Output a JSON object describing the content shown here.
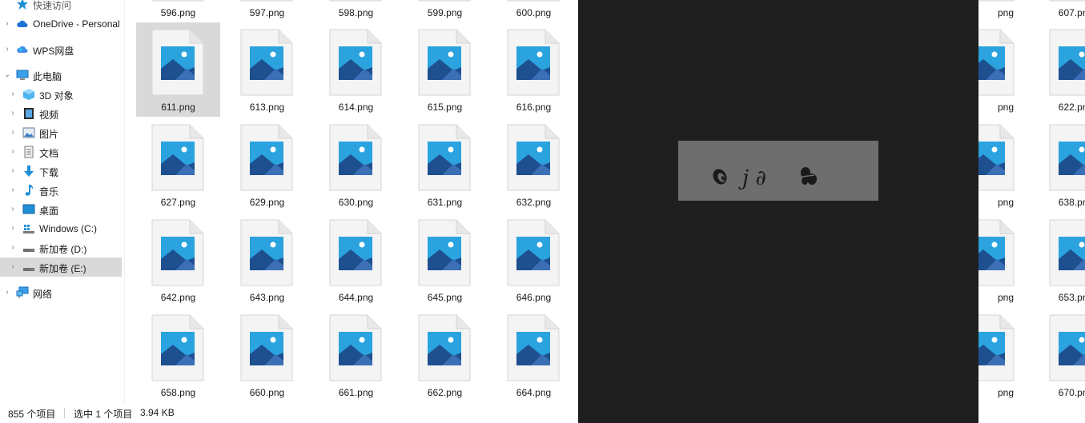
{
  "nav": {
    "items": [
      {
        "label": "快速访问",
        "icon": "star-icon"
      },
      {
        "label": "OneDrive - Personal",
        "icon": "cloud-icon"
      },
      {
        "label": "WPS网盘",
        "icon": "wps-cloud-icon"
      },
      {
        "label": "此电脑",
        "icon": "computer-icon"
      },
      {
        "label": "3D 对象",
        "icon": "cube-icon"
      },
      {
        "label": "视频",
        "icon": "video-icon"
      },
      {
        "label": "图片",
        "icon": "picture-icon"
      },
      {
        "label": "文档",
        "icon": "document-icon"
      },
      {
        "label": "下载",
        "icon": "download-icon"
      },
      {
        "label": "音乐",
        "icon": "music-icon"
      },
      {
        "label": "桌面",
        "icon": "desktop-icon"
      },
      {
        "label": "Windows (C:)",
        "icon": "windows-drive-icon"
      },
      {
        "label": "新加卷 (D:)",
        "icon": "drive-icon"
      },
      {
        "label": "新加卷 (E:)",
        "icon": "drive-icon"
      },
      {
        "label": "网络",
        "icon": "network-icon"
      }
    ],
    "selected": "新加卷 (E:)"
  },
  "files": {
    "rows": [
      [
        "596.png",
        "597.png",
        "598.png",
        "599.png",
        "600.png"
      ],
      [
        "611.png",
        "613.png",
        "614.png",
        "615.png",
        "616.png"
      ],
      [
        "627.png",
        "629.png",
        "630.png",
        "631.png",
        "632.png"
      ],
      [
        "642.png",
        "643.png",
        "644.png",
        "645.png",
        "646.png"
      ],
      [
        "658.png",
        "660.png",
        "661.png",
        "662.png",
        "664.png"
      ]
    ],
    "selected": "611.png",
    "right_rows": [
      [
        "png",
        "607.png"
      ],
      [
        "png",
        "622.png"
      ],
      [
        "png",
        "638.png"
      ],
      [
        "png",
        "653.png"
      ],
      [
        "png",
        "670.png"
      ]
    ]
  },
  "status": {
    "item_count": "855 个项目",
    "selection": "选中 1 个项目",
    "size": "3.94 KB"
  },
  "preview": {
    "glyphs": "j ∂"
  },
  "colors": {
    "selection": "#d9d9d9",
    "preview_bg": "#1f1f1f",
    "preview_image": "#6e6e6e",
    "accent_blue": "#1f8fd6"
  }
}
